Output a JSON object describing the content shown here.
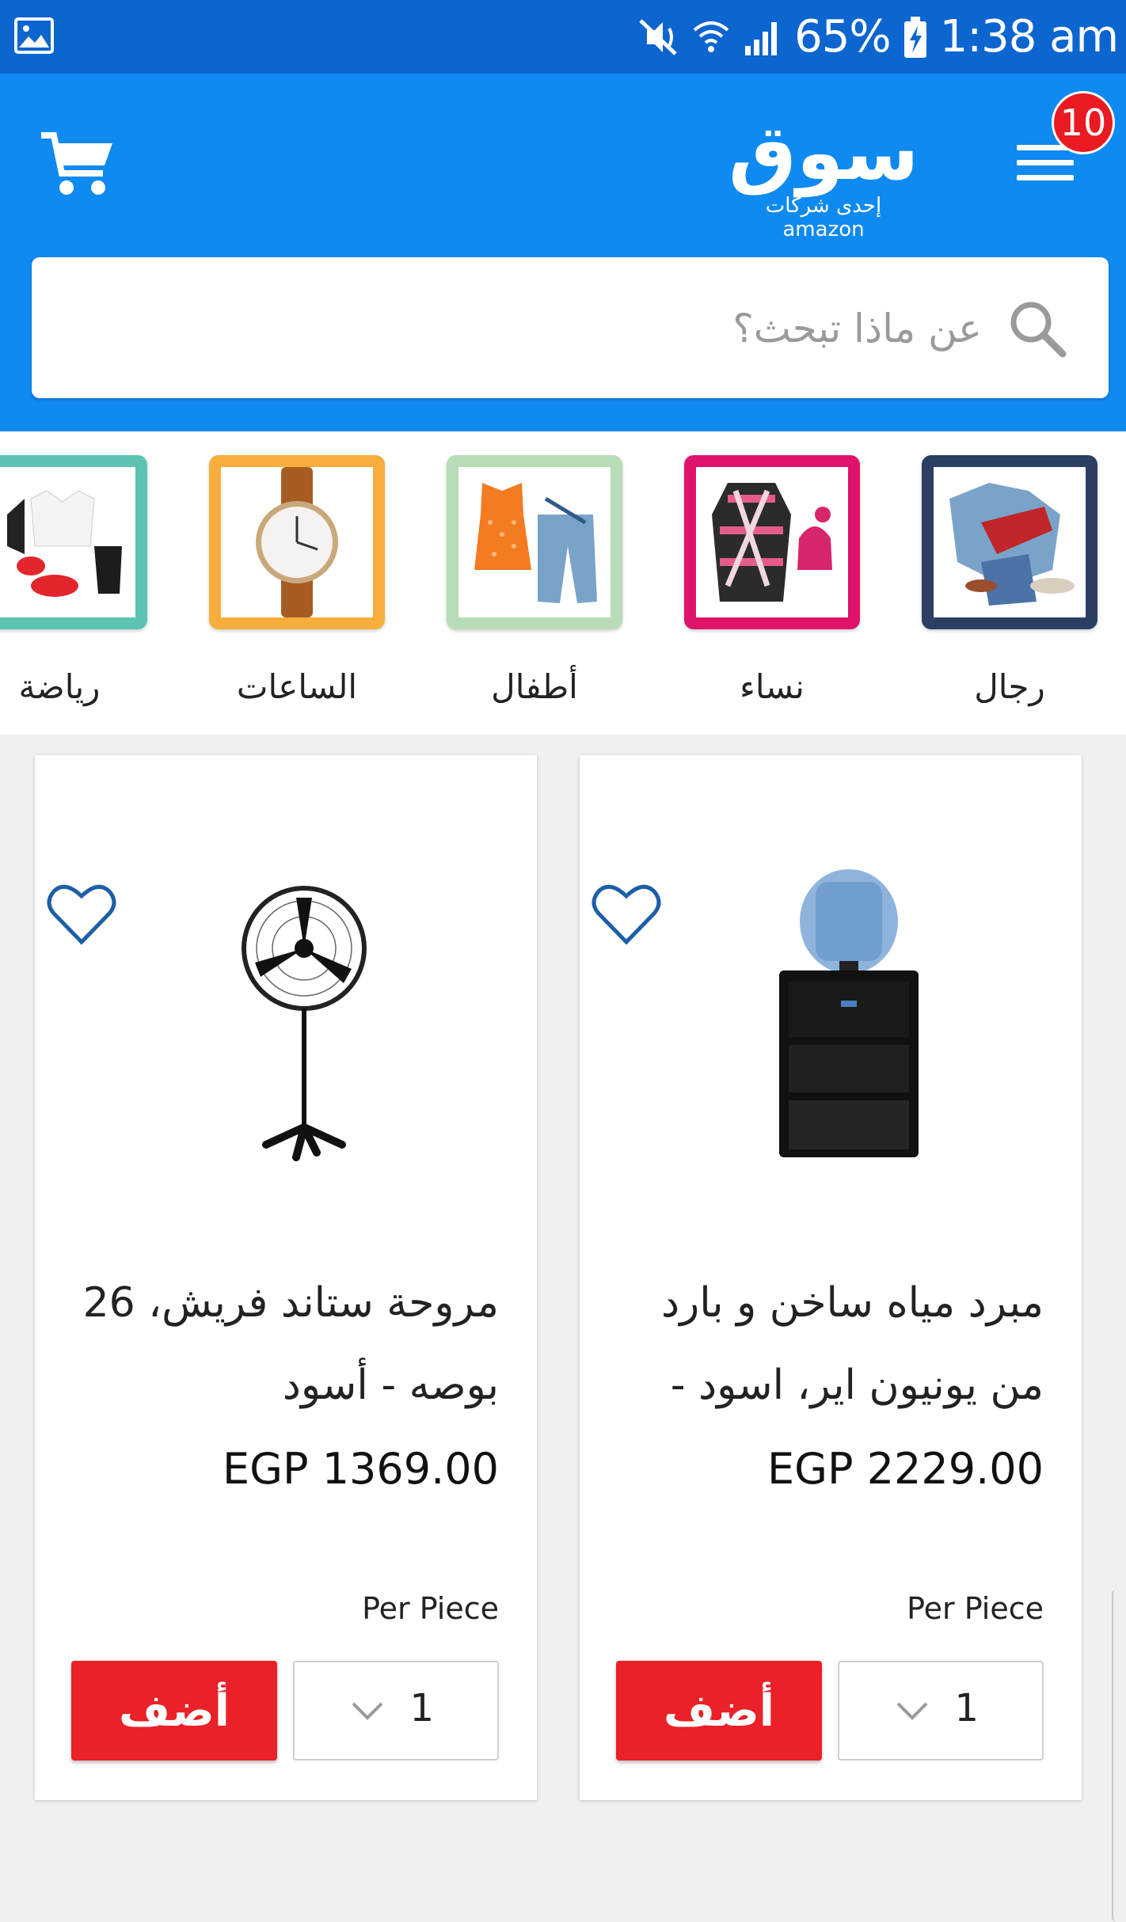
{
  "status_bar": {
    "battery": "65%",
    "time": "1:38 am",
    "icons": [
      "gallery-icon",
      "mute-vibrate-icon",
      "wifi-icon",
      "signal-icon",
      "battery-charging-icon"
    ]
  },
  "header": {
    "logo_main": "سوق",
    "logo_sub": "إحدى شركات amazon",
    "menu_badge": "10",
    "accent_color": "#0e8af0"
  },
  "search": {
    "placeholder": "عن ماذا تبحث؟"
  },
  "categories": [
    {
      "label": "رجال",
      "border": "#2a3f63"
    },
    {
      "label": "نساء",
      "border": "#e0136b"
    },
    {
      "label": "أطفال",
      "border": "#b7dcb6"
    },
    {
      "label": "الساعات",
      "border": "#f7ae3d"
    },
    {
      "label": "رياضة",
      "border": "#5cc2b2"
    }
  ],
  "products": [
    {
      "name": "مبرد مياه ساخن و بارد من يونيون اير، اسود -",
      "price": "EGP 2229.00",
      "unit": "Per Piece",
      "add_label": "أضف",
      "qty": "1"
    },
    {
      "name": "مروحة ستاند فريش، 26 بوصه - أسود",
      "price": "EGP 1369.00",
      "unit": "Per Piece",
      "add_label": "أضف",
      "qty": "1"
    }
  ]
}
